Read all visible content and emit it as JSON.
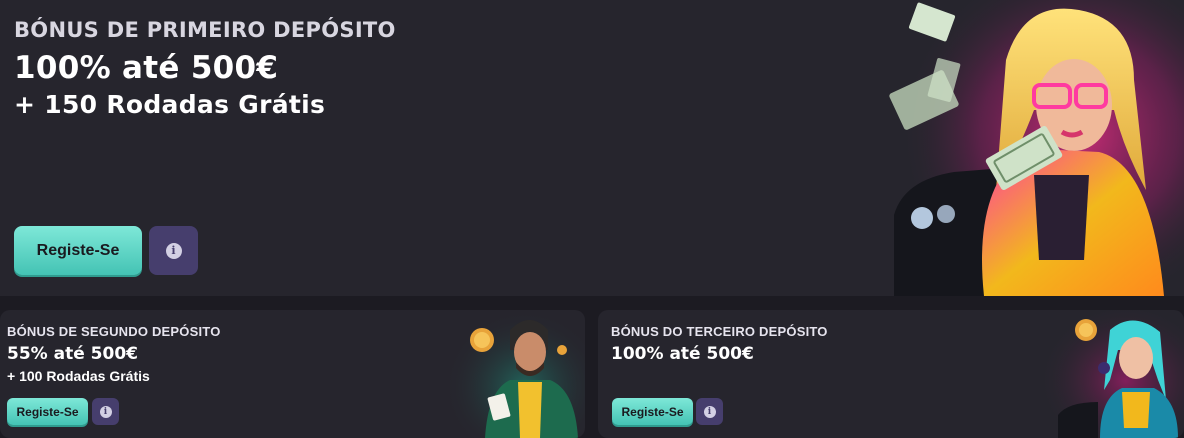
{
  "hero": {
    "kicker": "BÓNUS DE PRIMEIRO DEPÓSITO",
    "amount": "100% até 500€",
    "spins": "+ 150 Rodadas Grátis",
    "register_label": "Registe-Se",
    "info_symbol": "i"
  },
  "cards": [
    {
      "kicker": "BÓNUS DE SEGUNDO DEPÓSITO",
      "amount": "55% até 500€",
      "spins": "+ 100 Rodadas Grátis",
      "register_label": "Registe-Se",
      "info_symbol": "i"
    },
    {
      "kicker": "BÓNUS DO TERCEIRO DEPÓSITO",
      "amount": "100% até 500€",
      "register_label": "Registe-Se",
      "info_symbol": "i"
    }
  ],
  "colors": {
    "background": "#1c1b22",
    "panel": "#26252d",
    "accent_teal": "#5fd4c4",
    "info_purple": "#463e6d",
    "neon_pink": "#ff2f8e",
    "jacket_yellow": "#f2b81c"
  },
  "icons": {
    "info": "info-circle-icon",
    "money": "banknote-icon",
    "coin": "gold-coin-icon"
  }
}
